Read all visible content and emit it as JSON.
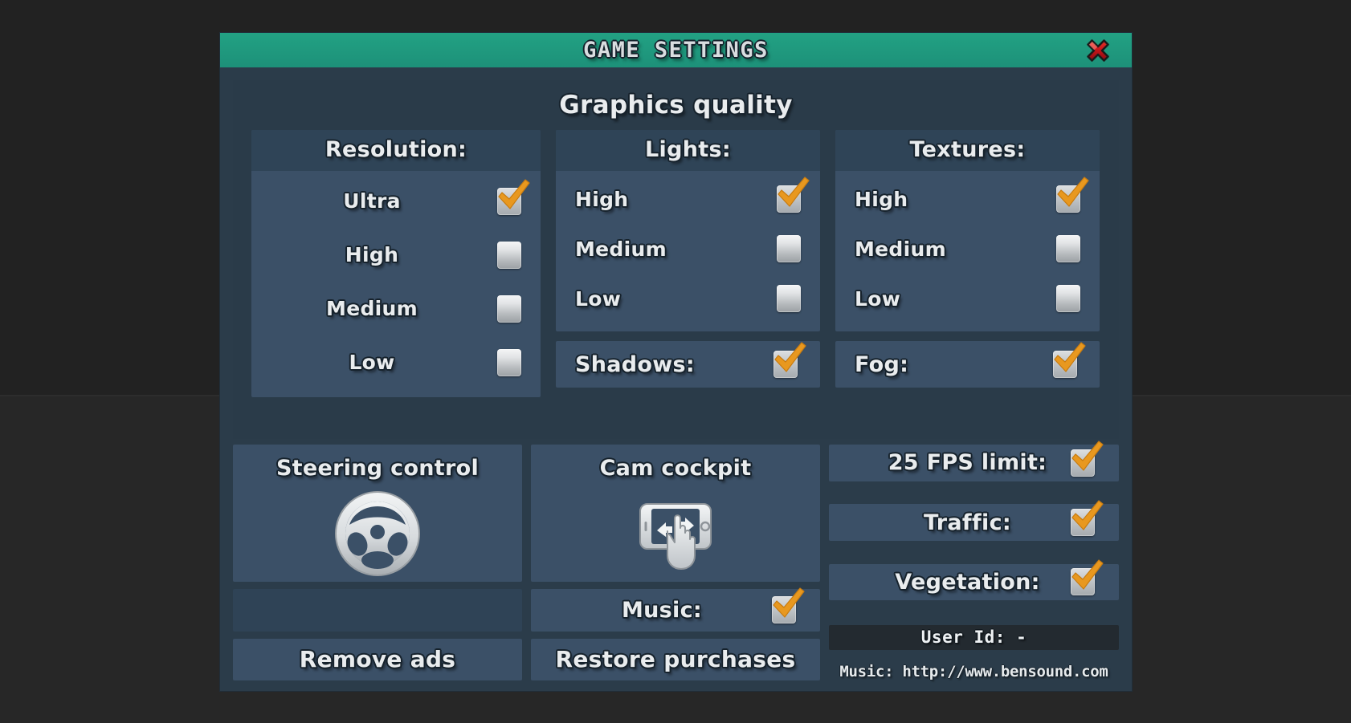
{
  "window": {
    "title": "GAME SETTINGS",
    "close_icon": "close-x-icon",
    "titlebar_color": "#1f9c80",
    "dialog_color": "#2b3c4a",
    "panel_color": "#3b5067",
    "panel_header_color": "#2f4457",
    "check_color": "#e8981f"
  },
  "graphics": {
    "section_title": "Graphics quality",
    "resolution": {
      "header": "Resolution:",
      "options": [
        {
          "label": "Ultra",
          "checked": true
        },
        {
          "label": "High",
          "checked": false
        },
        {
          "label": "Medium",
          "checked": false
        },
        {
          "label": "Low",
          "checked": false
        }
      ]
    },
    "lights": {
      "header": "Lights:",
      "options": [
        {
          "label": "High",
          "checked": true
        },
        {
          "label": "Medium",
          "checked": false
        },
        {
          "label": "Low",
          "checked": false
        }
      ]
    },
    "textures": {
      "header": "Textures:",
      "options": [
        {
          "label": "High",
          "checked": true
        },
        {
          "label": "Medium",
          "checked": false
        },
        {
          "label": "Low",
          "checked": false
        }
      ]
    },
    "shadows": {
      "label": "Shadows:",
      "checked": true
    },
    "fog": {
      "label": "Fog:",
      "checked": true
    }
  },
  "controls": {
    "steering": {
      "title": "Steering control",
      "icon": "steering-wheel-icon"
    },
    "cam": {
      "title": "Cam cockpit",
      "icon": "phone-swipe-icon"
    },
    "music": {
      "label": "Music:",
      "checked": true
    },
    "remove_ads": "Remove ads",
    "restore_purchases": "Restore purchases"
  },
  "toggles": [
    {
      "label": "25 FPS limit:",
      "checked": true
    },
    {
      "label": "Traffic:",
      "checked": true
    },
    {
      "label": "Vegetation:",
      "checked": true
    }
  ],
  "account": {
    "user_id": "User Id: -",
    "music_credit": "Music: http://www.bensound.com"
  }
}
